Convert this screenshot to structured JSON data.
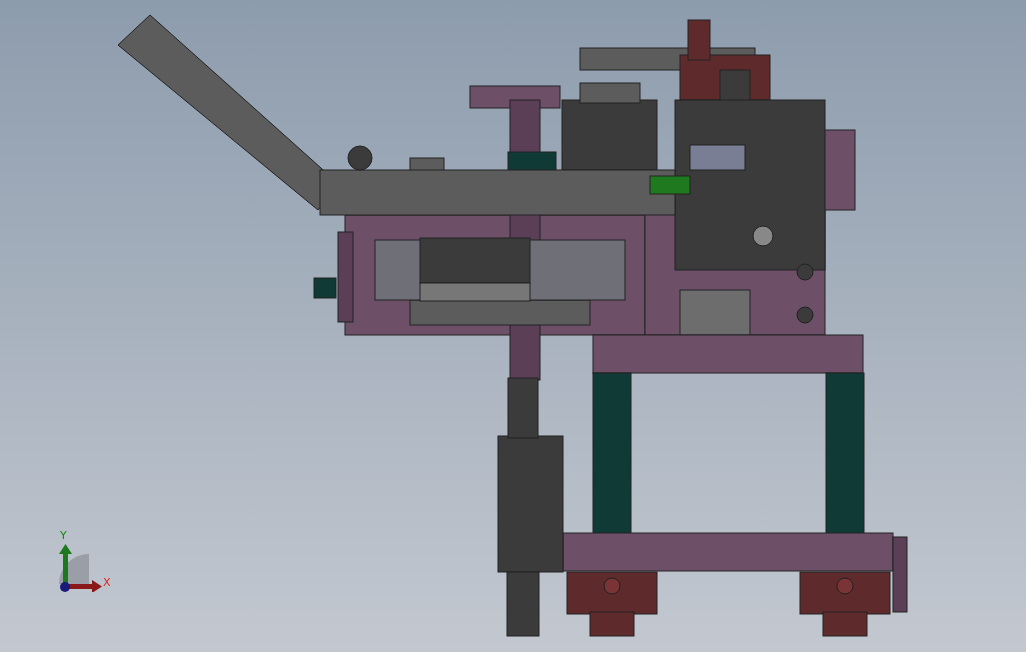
{
  "viewport": {
    "axis_triad": {
      "y_label": "Y",
      "x_label": "X"
    }
  }
}
